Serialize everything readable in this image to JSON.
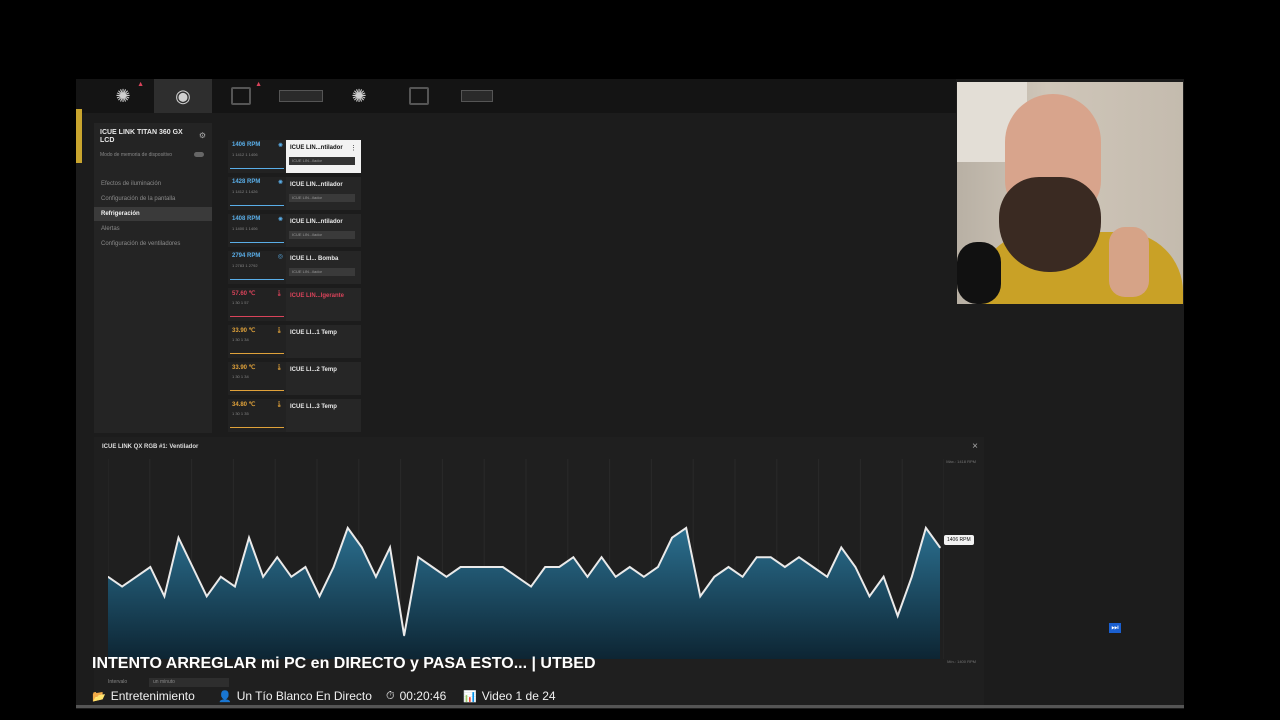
{
  "app": {
    "device_title": "ICUE LINK TITAN 360 GX LCD",
    "device_subtitle": "Modo de memoria de dispositivo",
    "menu": [
      {
        "label": "Efectos de iluminación",
        "active": false
      },
      {
        "label": "Configuración de la pantalla",
        "active": false
      },
      {
        "label": "Refrigeración",
        "active": true
      },
      {
        "label": "Alertas",
        "active": false
      },
      {
        "label": "Configuración de ventiladores",
        "active": false
      }
    ],
    "sensors": [
      {
        "value": "1406 RPM",
        "sub": "1 1412  1 1406",
        "label": "ICUE LIN...ntilador",
        "dropdown": "ICUE LIN...ilador",
        "color": "#5aaee8",
        "icon": "fan-icon"
      },
      {
        "value": "1428 RPM",
        "sub": "1 1412  1 1426",
        "label": "ICUE LIN...ntilador",
        "dropdown": "ICUE LIN...ilador",
        "color": "#5aaee8",
        "icon": "fan-icon"
      },
      {
        "value": "1408 RPM",
        "sub": "1 1400  1 1406",
        "label": "ICUE LIN...ntilador",
        "dropdown": "ICUE LIN...ilador",
        "color": "#5aaee8",
        "icon": "fan-icon"
      },
      {
        "value": "2794 RPM",
        "sub": "1 2783  1 2792",
        "label": "ICUE LI... Bomba",
        "dropdown": "ICUE LIN...ilador",
        "color": "#5aaee8",
        "icon": "pump-icon"
      },
      {
        "value": "57.60 ℃",
        "sub": "1 30  1 57",
        "label": "ICUE LIN...Igerante",
        "dropdown": "",
        "color": "#d9435a",
        "icon": "thermometer-icon"
      },
      {
        "value": "33.90 ℃",
        "sub": "1 30  1 34",
        "label": "ICUE LI...1 Temp",
        "dropdown": "",
        "color": "#e0a23a",
        "icon": "thermometer-icon"
      },
      {
        "value": "33.90 ℃",
        "sub": "1 30  1 34",
        "label": "ICUE LI...2 Temp",
        "dropdown": "",
        "color": "#e0a23a",
        "icon": "thermometer-icon"
      },
      {
        "value": "34.80 ℃",
        "sub": "1 30  1 35",
        "label": "ICUE LI...3 Temp",
        "dropdown": "",
        "color": "#e0a23a",
        "icon": "thermometer-icon"
      }
    ],
    "panel": {
      "title": "ICUE LINK QX RGB #1: Ventilador",
      "max_label": "Máx.: 1418 RPM",
      "min_label": "Mín.: 1400 RPM",
      "current_tag": "1406 RPM",
      "interval_label": "Intervalo",
      "interval_value": "un minuto"
    }
  },
  "chart_data": {
    "type": "area",
    "title": "ICUE LINK QX RGB #1: Ventilador",
    "unit": "RPM",
    "ylim": [
      1400,
      1418
    ],
    "values": [
      1408,
      1407,
      1408,
      1409,
      1406,
      1412,
      1409,
      1406,
      1408,
      1407,
      1412,
      1408,
      1410,
      1408,
      1409,
      1406,
      1409,
      1413,
      1411,
      1408,
      1411,
      1402,
      1410,
      1409,
      1408,
      1409,
      1409,
      1409,
      1409,
      1408,
      1407,
      1409,
      1409,
      1410,
      1408,
      1410,
      1408,
      1409,
      1408,
      1409,
      1412,
      1413,
      1406,
      1408,
      1409,
      1408,
      1410,
      1410,
      1409,
      1410,
      1409,
      1408,
      1411,
      1409,
      1406,
      1408,
      1404,
      1408,
      1413,
      1411
    ]
  },
  "overlay": {
    "video_title": "INTENTO ARREGLAR mi PC en DIRECTO y PASA ESTO... | UTBED",
    "category": "Entretenimiento",
    "channel": "Un Tío Blanco En Directo",
    "duration": "00:20:46",
    "playlist_position": "Video 1 de 24"
  },
  "colors": {
    "fan_series": "#5aaee8",
    "coolant_alert": "#d9435a",
    "temp_series": "#e0a23a",
    "area_fill_top": "#2b6f8f"
  }
}
